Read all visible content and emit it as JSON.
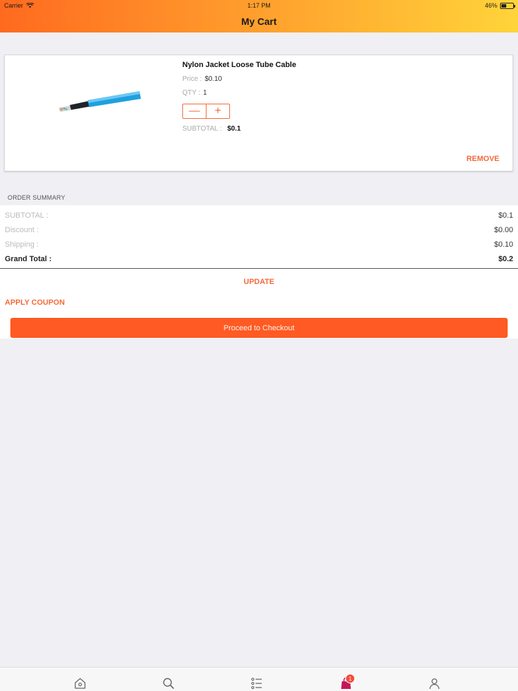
{
  "status_bar": {
    "carrier": "Carrier",
    "time": "1:17 PM",
    "battery_text": "46%",
    "battery_level": 0.46
  },
  "header": {
    "title": "My Cart"
  },
  "cart_item": {
    "name": "Nylon Jacket Loose Tube Cable",
    "price_label": "Price :",
    "price": "$0.10",
    "qty_label": "QTY :",
    "qty": "1",
    "minus": "—",
    "plus": "+",
    "subtotal_label": "SUBTOTAL :",
    "subtotal": "$0.1",
    "remove_label": "REMOVE"
  },
  "order_summary": {
    "heading": "ORDER SUMMARY",
    "rows": [
      {
        "label": "SUBTOTAL :",
        "value": "$0.1"
      },
      {
        "label": "Discount :",
        "value": "$0.00"
      },
      {
        "label": "Shipping :",
        "value": "$0.10"
      },
      {
        "label": "Grand Total :",
        "value": "$0.2"
      }
    ]
  },
  "actions": {
    "update_label": "UPDATE",
    "coupon_label": "APPLY COUPON",
    "checkout_label": "Proceed to Checkout"
  },
  "tab_bar": {
    "items": [
      {
        "icon": "home-icon"
      },
      {
        "icon": "search-icon"
      },
      {
        "icon": "list-icon"
      },
      {
        "icon": "cart-bag-icon",
        "badge": "1"
      },
      {
        "icon": "profile-icon"
      }
    ]
  },
  "colors": {
    "accent": "#f36b3b",
    "checkout": "#ff5a23",
    "header_start": "#ff6a1f",
    "header_end": "#ffd43a",
    "badge": "#f24c3c",
    "cart_active": "#c2185b"
  }
}
